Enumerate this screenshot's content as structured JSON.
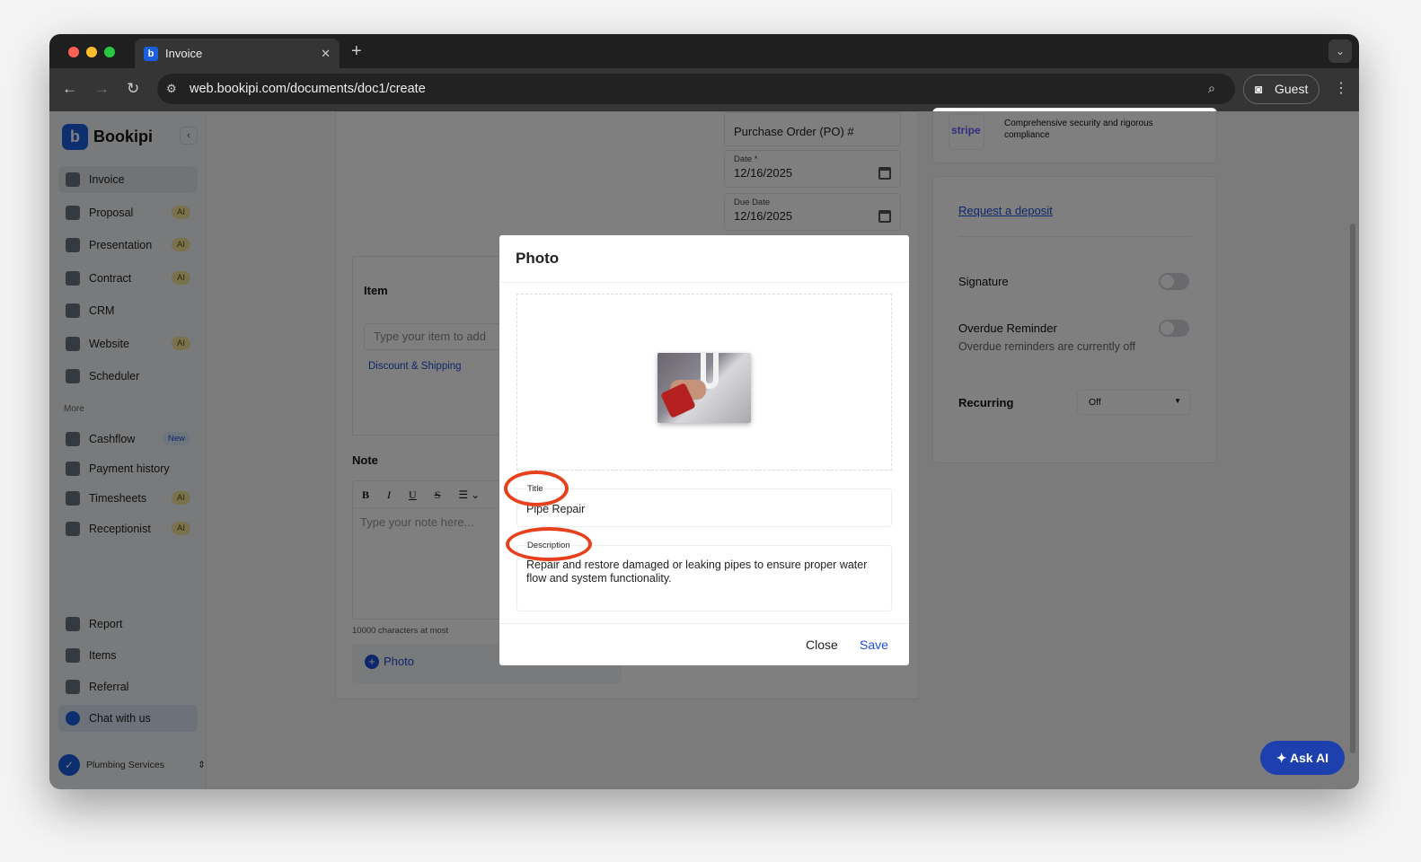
{
  "browser": {
    "tab_title": "Invoice",
    "url": "web.bookipi.com/documents/doc1/create",
    "profile": "Guest"
  },
  "sidebar": {
    "brand": "Bookipi",
    "items": [
      {
        "label": "Invoice"
      },
      {
        "label": "Proposal",
        "badge": "AI"
      },
      {
        "label": "Presentation",
        "badge": "AI"
      },
      {
        "label": "Contract",
        "badge": "AI"
      },
      {
        "label": "CRM"
      },
      {
        "label": "Website",
        "badge": "AI"
      },
      {
        "label": "Scheduler"
      }
    ],
    "more_label": "More",
    "more_items": [
      {
        "label": "Cashflow",
        "badge": "New"
      },
      {
        "label": "Payment history"
      },
      {
        "label": "Timesheets",
        "badge": "AI"
      },
      {
        "label": "Receptionist",
        "badge": "AI"
      }
    ],
    "bottom_items": [
      {
        "label": "Report"
      },
      {
        "label": "Items"
      },
      {
        "label": "Referral"
      },
      {
        "label": "Chat with us"
      }
    ],
    "business": "Plumbing Services"
  },
  "form": {
    "po_label": "Purchase Order (PO) #",
    "date_label": "Date *",
    "date": "12/16/2025",
    "due_label": "Due Date",
    "due_date": "12/16/2025",
    "item_header": "Item",
    "item_placeholder": "Type your item to add",
    "discount_link": "Discount & Shipping",
    "note_header": "Note",
    "note_placeholder": "Type your note here...",
    "note_limit": "10000 characters at most",
    "photo_button": "Photo",
    "toolbar": [
      "B",
      "I",
      "U",
      "S"
    ]
  },
  "right": {
    "stripe": "stripe",
    "security_text": "Comprehensive security and rigorous compliance",
    "deposit_link": "Request a deposit",
    "signature": "Signature",
    "signature_on": false,
    "overdue": "Overdue Reminder",
    "overdue_on": false,
    "overdue_sub": "Overdue reminders are currently off",
    "recurring": "Recurring",
    "recurring_value": "Off"
  },
  "modal": {
    "title": "Photo",
    "title_label": "Title",
    "title_value": "Pipe Repair",
    "desc_label": "Description",
    "desc_value": "Repair and restore damaged or leaking pipes to ensure proper water flow and system functionality.",
    "close": "Close",
    "save": "Save"
  },
  "ask_ai": "Ask AI"
}
